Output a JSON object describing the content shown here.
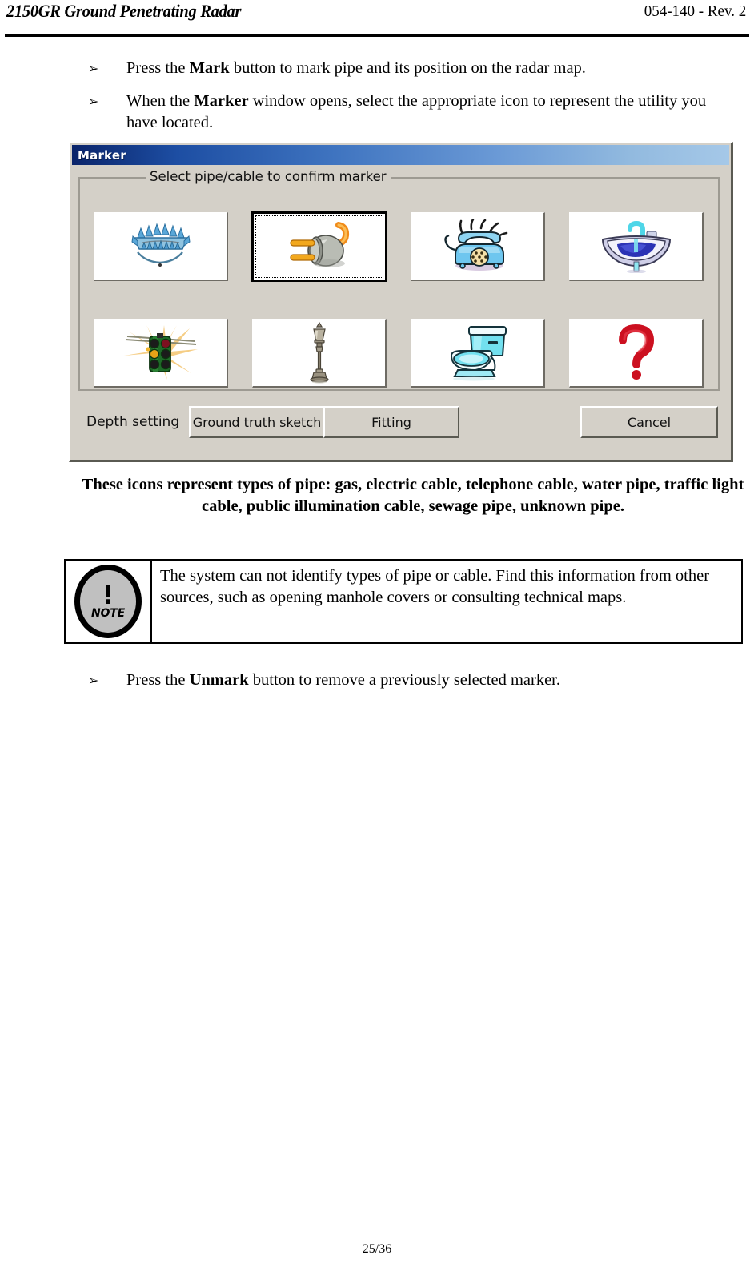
{
  "header": {
    "title": "2150GR Ground Penetrating Radar",
    "doc_number": "054-140 - Rev. 2"
  },
  "bullets": {
    "first": {
      "prefix": "Press the ",
      "bold": "Mark",
      "suffix": " button to mark pipe and its position on the radar map."
    },
    "second": {
      "prefix": "When the ",
      "bold": "Marker",
      "suffix": " window opens, select the appropriate icon to represent the utility you have located."
    },
    "third": {
      "prefix": "Press the  ",
      "bold": "Unmark",
      "suffix": "  button to remove a previously selected marker."
    },
    "arrow_glyph": "➢"
  },
  "dialog": {
    "title": "Marker",
    "groupbox_label": "Select pipe/cable to confirm marker",
    "depth_setting_label": "Depth setting",
    "buttons": {
      "ground_truth": "Ground truth sketch",
      "fitting": "Fitting",
      "cancel": "Cancel"
    },
    "icons": [
      {
        "name": "gas-burner-icon",
        "label": "gas",
        "selected": false
      },
      {
        "name": "electric-plug-icon",
        "label": "electric cable",
        "selected": true
      },
      {
        "name": "telephone-icon",
        "label": "telephone cable",
        "selected": false
      },
      {
        "name": "washbasin-icon",
        "label": "water pipe",
        "selected": false
      },
      {
        "name": "traffic-light-icon",
        "label": "traffic light cable",
        "selected": false
      },
      {
        "name": "street-lamp-icon",
        "label": "public illumination cable",
        "selected": false
      },
      {
        "name": "toilet-icon",
        "label": "sewage pipe",
        "selected": false
      },
      {
        "name": "question-mark-icon",
        "label": "unknown pipe",
        "selected": false
      }
    ],
    "colors": {
      "titlebar_dark": "#0a246a",
      "titlebar_light": "#a5c8e8",
      "face": "#d4d0c8",
      "shadow": "#5a5a52"
    }
  },
  "caption": {
    "line1": "These icons represent types of pipe: gas, electric cable, telephone cable, water pipe,",
    "line2": "traffic light cable, public illumination cable, sewage pipe, unknown pipe."
  },
  "note": {
    "symbol": "!",
    "word": "NOTE",
    "text": "The system can not identify types of pipe or cable. Find this information from other sources, such as opening manhole covers or consulting technical maps."
  },
  "footer": {
    "page": "25/36"
  }
}
